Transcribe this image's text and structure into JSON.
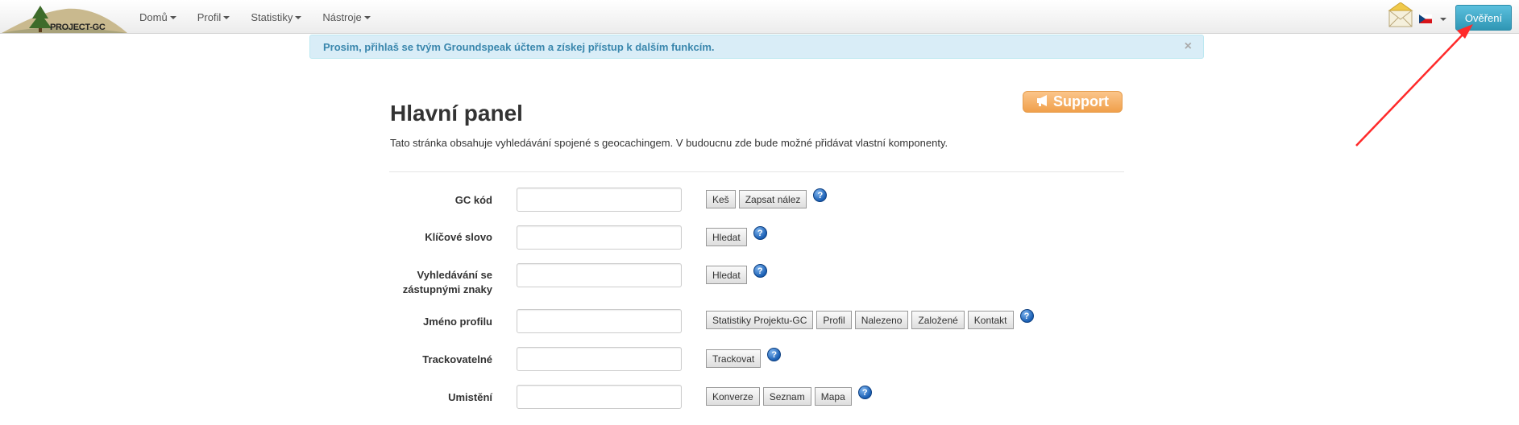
{
  "navbar": {
    "logo_text": "PROJECT-GC",
    "menu": [
      {
        "label": "Domů"
      },
      {
        "label": "Profil"
      },
      {
        "label": "Statistiky"
      },
      {
        "label": "Nástroje"
      }
    ],
    "mail_icon": "envelope-icon",
    "flag_icon": "czech-flag-icon",
    "login_label": "Ověření"
  },
  "alert": {
    "text": "Prosim, přihlaš se tvým Groundspeak účtem a získej přístup k dalším funkcím.",
    "close": "×"
  },
  "support": {
    "label": "Support",
    "icon": "megaphone-icon"
  },
  "page": {
    "title": "Hlavní panel",
    "description": "Tato stránka obsahuje vyhledávání spojené s geocachingem. V budoucnu zde bude možné přidávat vlastní komponenty."
  },
  "form": {
    "help_symbol": "?",
    "rows": [
      {
        "label": "GC kód",
        "buttons": [
          "Keš",
          "Zapsat nález"
        ]
      },
      {
        "label": "Klíčové slovo",
        "buttons": [
          "Hledat"
        ]
      },
      {
        "label": "Vyhledávání se zástupnými znaky",
        "buttons": [
          "Hledat"
        ]
      },
      {
        "label": "Jméno profilu",
        "buttons": [
          "Statistiky Projektu-GC",
          "Profil",
          "Nalezeno",
          "Založené",
          "Kontakt"
        ]
      },
      {
        "label": "Trackovatelné",
        "buttons": [
          "Trackovat"
        ]
      },
      {
        "label": "Umistění",
        "buttons": [
          "Konverze",
          "Seznam",
          "Mapa"
        ]
      }
    ]
  },
  "colors": {
    "login_button": "#2f96b4",
    "alert_bg": "#d9edf7",
    "alert_text": "#3a87ad",
    "support_button": "#f0a04b",
    "annotation_arrow": "#ff0000"
  }
}
